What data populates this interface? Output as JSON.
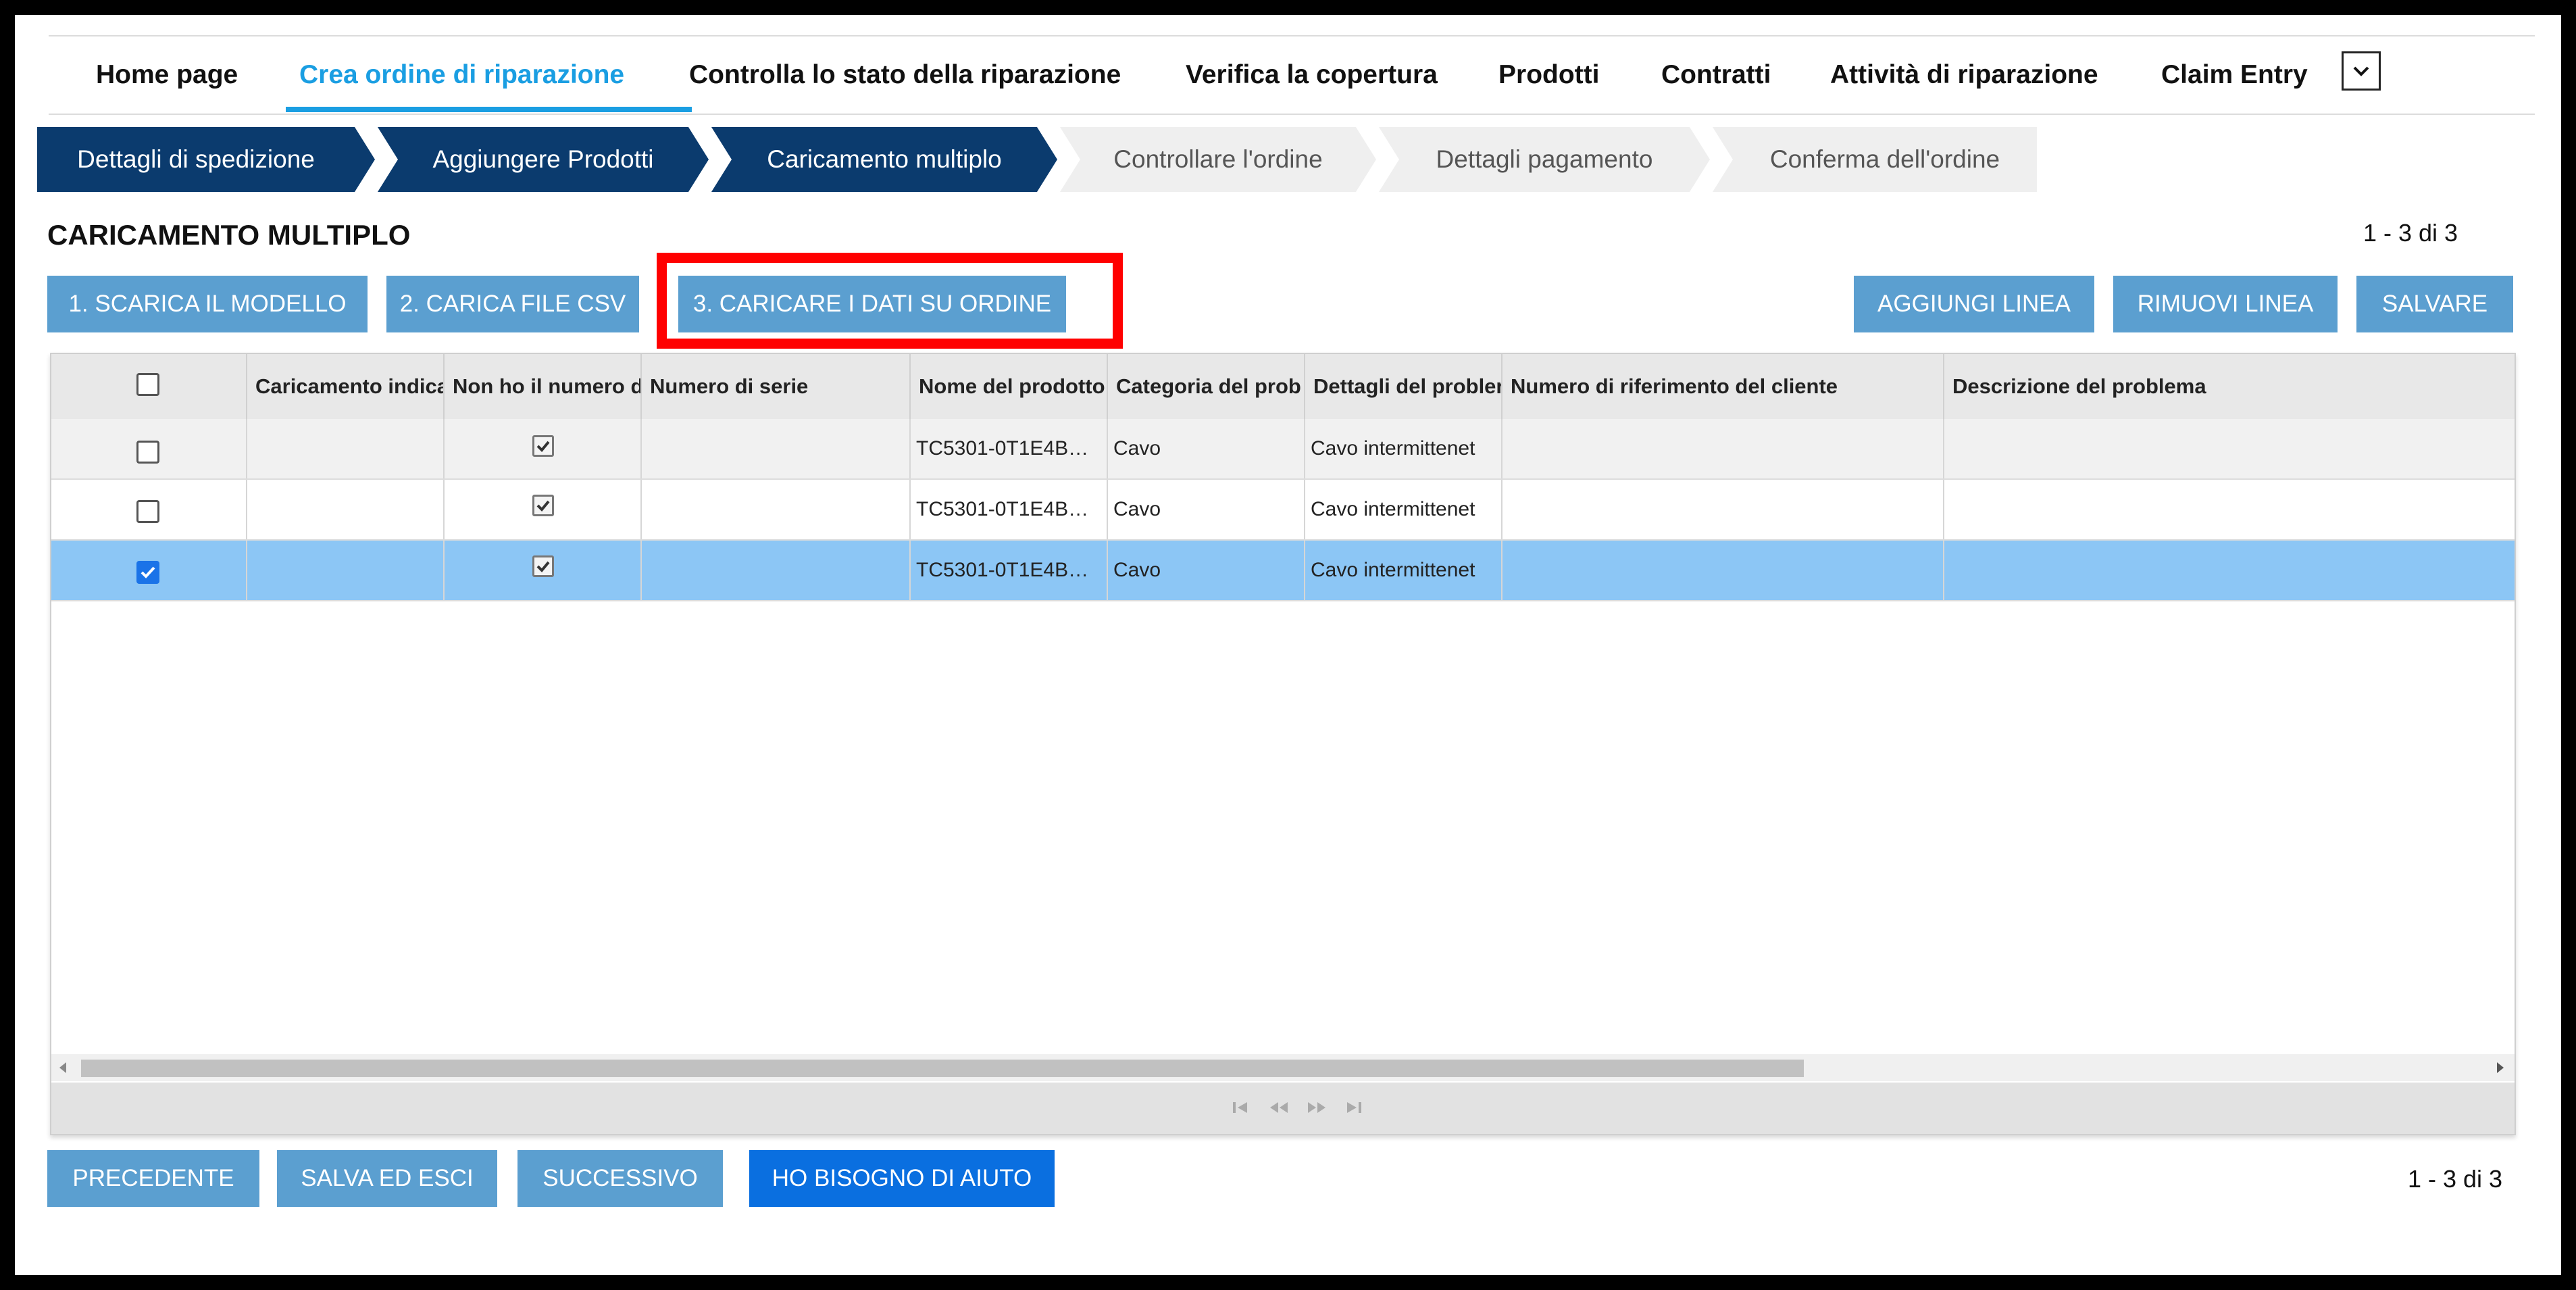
{
  "nav": {
    "items": [
      {
        "label": "Home page",
        "active": false
      },
      {
        "label": "Crea ordine di riparazione",
        "active": true
      },
      {
        "label": "Controlla lo stato della riparazione",
        "active": false
      },
      {
        "label": "Verifica la copertura",
        "active": false
      },
      {
        "label": "Prodotti",
        "active": false
      },
      {
        "label": "Contratti",
        "active": false
      },
      {
        "label": "Attività di riparazione",
        "active": false
      },
      {
        "label": "Claim Entry",
        "active": false
      }
    ],
    "more_icon": "chevron-down-icon"
  },
  "steps": [
    {
      "label": "Dettagli di spedizione",
      "state": "done"
    },
    {
      "label": "Aggiungere Prodotti",
      "state": "done"
    },
    {
      "label": "Caricamento multiplo",
      "state": "current"
    },
    {
      "label": "Controllare l'ordine",
      "state": "todo"
    },
    {
      "label": "Dettagli pagamento",
      "state": "todo"
    },
    {
      "label": "Conferma dell'ordine",
      "state": "todo"
    }
  ],
  "page": {
    "title": "CARICAMENTO MULTIPLO",
    "pager_top": "1 - 3 di 3",
    "pager_bottom": "1 - 3 di 3"
  },
  "toolbar": {
    "download_template": "1. SCARICA IL MODELLO",
    "upload_csv": "2. CARICA FILE CSV",
    "load_data": "3. CARICARE I DATI SU ORDINE",
    "add_line": "AGGIUNGI LINEA",
    "remove_line": "RIMUOVI LINEA",
    "save": "SALVARE"
  },
  "grid": {
    "columns": [
      "Caricamento indica",
      "Non ho il numero d",
      "Numero di serie",
      "Nome del prodotto",
      "Categoria del prob",
      "Dettagli del probler",
      "Numero di riferimento del cliente",
      "Descrizione del problema"
    ],
    "rows": [
      {
        "selected": false,
        "upload": "",
        "no_serial": true,
        "serial": "",
        "product": "TC5301-0T1E4B…",
        "category": "Cavo",
        "details": "Cavo intermittenet",
        "ref": "",
        "description": ""
      },
      {
        "selected": false,
        "upload": "",
        "no_serial": true,
        "serial": "",
        "product": "TC5301-0T1E4B…",
        "category": "Cavo",
        "details": "Cavo intermittenet",
        "ref": "",
        "description": ""
      },
      {
        "selected": true,
        "upload": "",
        "no_serial": true,
        "serial": "",
        "product": "TC5301-0T1E4B…",
        "category": "Cavo",
        "details": "Cavo intermittenet",
        "ref": "",
        "description": ""
      }
    ]
  },
  "footer": {
    "previous": "PRECEDENTE",
    "save_exit": "SALVA ED ESCI",
    "next": "SUCCESSIVO",
    "help": "HO BISOGNO DI AIUTO"
  },
  "colors": {
    "accent": "#1a9ee2",
    "step_done": "#0b3b6e",
    "button": "#5b9fd0",
    "button_primary": "#0a6fe0",
    "row_selected": "#8cc6f5",
    "highlight": "#ff0000"
  }
}
